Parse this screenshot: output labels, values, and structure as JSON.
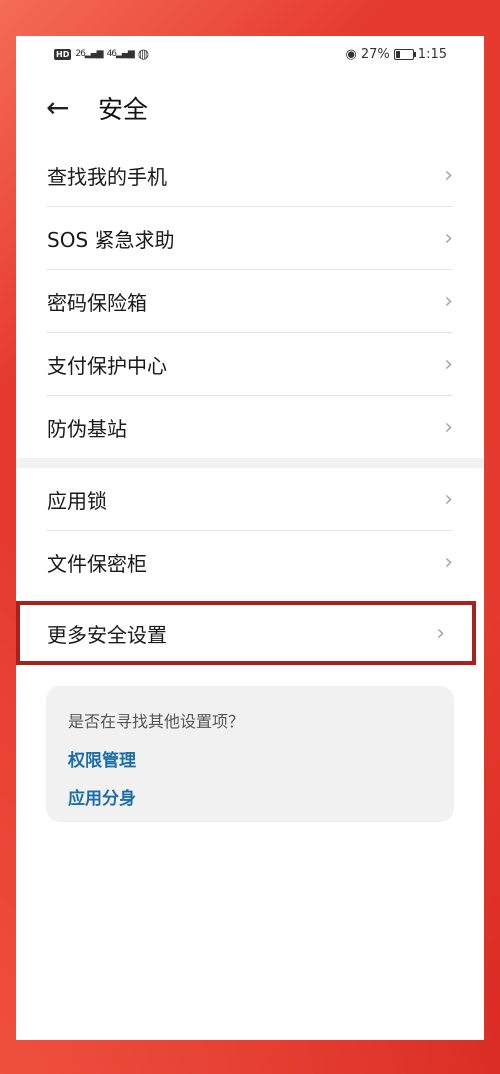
{
  "status_bar": {
    "hd": "HD",
    "signal1": "26",
    "signal2": "46",
    "battery_percent": "27%",
    "battery_level": 0.27,
    "time": "1:15"
  },
  "header": {
    "title": "安全"
  },
  "section1": [
    {
      "label": "查找我的手机"
    },
    {
      "label": "SOS 紧急求助"
    },
    {
      "label": "密码保险箱"
    },
    {
      "label": "支付保护中心"
    },
    {
      "label": "防伪基站"
    }
  ],
  "section2": [
    {
      "label": "应用锁"
    },
    {
      "label": "文件保密柜"
    }
  ],
  "more": {
    "label": "更多安全设置"
  },
  "suggestions": {
    "question": "是否在寻找其他设置项？",
    "links": [
      {
        "label": "权限管理"
      },
      {
        "label": "应用分身"
      }
    ]
  },
  "colors": {
    "accent_link": "#1c6ea8",
    "highlight_border": "#a5231c"
  }
}
